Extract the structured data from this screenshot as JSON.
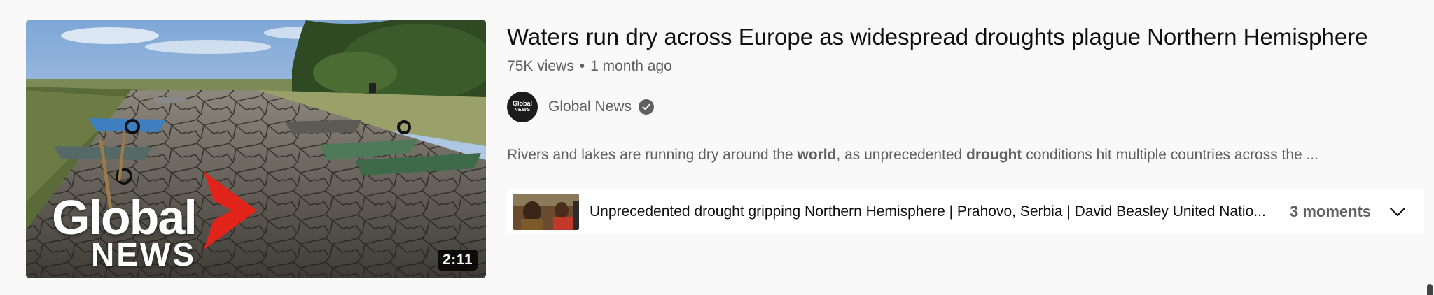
{
  "video": {
    "title": "Waters run dry across Europe as widespread droughts plague Northern Hemisphere",
    "views": "75K views",
    "separator": "•",
    "age": "1 month ago",
    "duration": "2:11",
    "thumbnail_brand": {
      "word": "Global",
      "sub": "NEWS"
    }
  },
  "channel": {
    "name": "Global News",
    "avatar_line1": "Global",
    "avatar_line2": "NEWS",
    "verified_icon": "check-circle-icon"
  },
  "description": {
    "part1": "Rivers and lakes are running dry around the ",
    "bold1": "world",
    "part2": ", as unprecedented ",
    "bold2": "drought",
    "part3": " conditions hit multiple countries across the ..."
  },
  "chapters": {
    "title": "Unprecedented drought gripping Northern Hemisphere | Prahovo, Serbia | David Beasley United Natio...",
    "moments": "3 moments",
    "toggle_icon": "chevron-down-icon"
  },
  "colors": {
    "page_bg": "#f9f9f9",
    "text_primary": "#0f0f0f",
    "text_secondary": "#606060",
    "brand_red": "#e2231a"
  }
}
